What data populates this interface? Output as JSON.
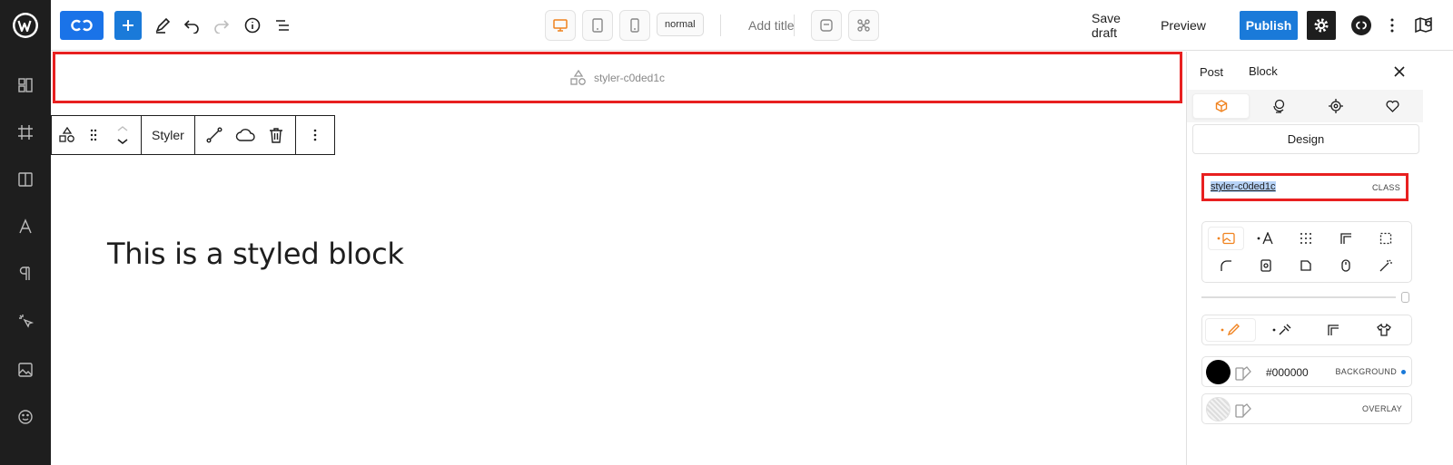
{
  "topbar": {
    "mode_label": "normal",
    "add_title": "Add title",
    "save_draft": "Save draft",
    "preview": "Preview",
    "publish": "Publish"
  },
  "canvas": {
    "block_class_label": "styler-c0ded1c",
    "toolbar_label": "Styler",
    "heading": "This is a styled block"
  },
  "panel": {
    "tabs": [
      "Post",
      "Block"
    ],
    "active_tab": "Block",
    "design_button": "Design",
    "class_value": "styler-c0ded1c",
    "class_tag": "CLASS",
    "background_hex": "#000000",
    "background_label": "BACKGROUND",
    "overlay_label": "OVERLAY"
  },
  "colors": {
    "accent": "#1a7ad9",
    "highlight": "#e82020",
    "active_orange": "#f0821e",
    "background_swatch": "#000000"
  },
  "icons": {
    "rail": [
      "wordpress-logo",
      "blocks-icon",
      "frame-icon",
      "layout-icon",
      "typography-icon",
      "paragraph-icon",
      "interactions-icon",
      "media-icon",
      "emoji-icon"
    ]
  }
}
